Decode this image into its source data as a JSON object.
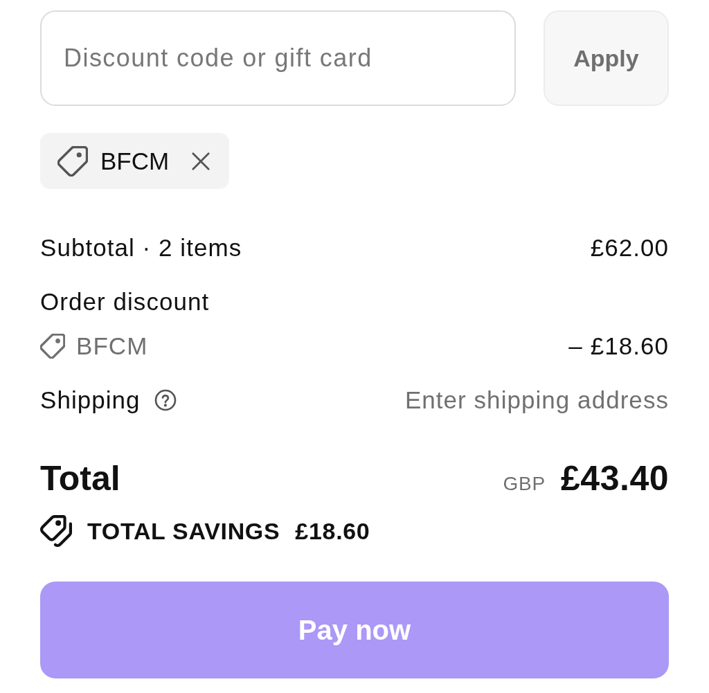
{
  "discount": {
    "field": {
      "placeholder": "Discount code or gift card"
    },
    "apply_button": {
      "label": "Apply",
      "disabled": true
    }
  },
  "applied_codes": [
    {
      "code": "BFCM"
    }
  ],
  "summary": {
    "rows": [
      {
        "kind": "line",
        "label": "Subtotal · 2 items",
        "value": "£62.00"
      },
      {
        "kind": "discount",
        "label": "Order discount",
        "code": "BFCM",
        "value": "– £18.60"
      },
      {
        "kind": "help",
        "label": "Shipping",
        "value": "Enter shipping address"
      }
    ]
  },
  "total": {
    "label": "Total",
    "currency": "GBP",
    "amount": "£43.40"
  },
  "savings": {
    "label": "TOTAL SAVINGS",
    "amount": "£18.60"
  },
  "pay_button": {
    "label": "Pay now"
  }
}
